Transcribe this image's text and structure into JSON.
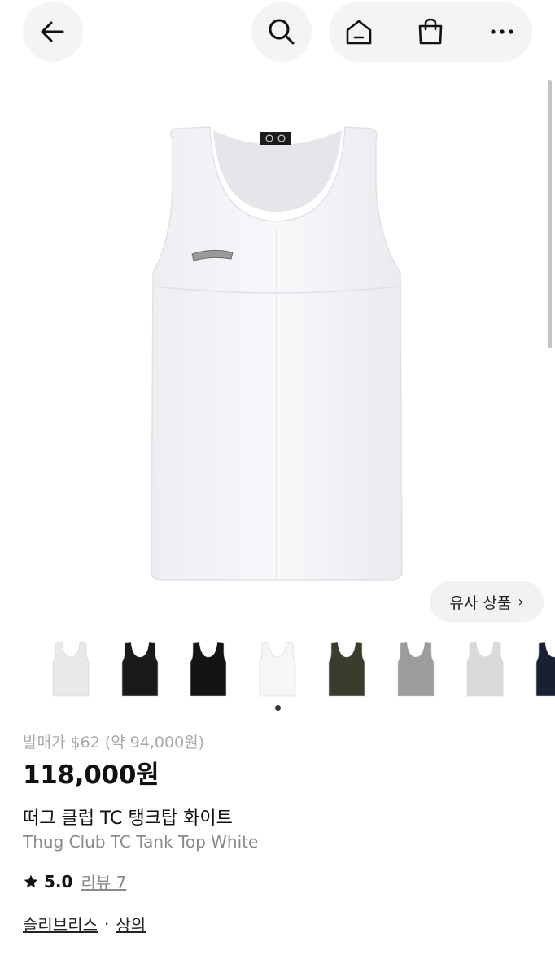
{
  "nav": {
    "icons": [
      "back-arrow-icon",
      "search-icon",
      "home-icon",
      "shopping-bag-icon",
      "more-icon"
    ]
  },
  "similar": {
    "label": "유사 상품",
    "chevron": "›"
  },
  "thumbnails": [
    {
      "color": "#e9e9e9"
    },
    {
      "color": "#1a1a1a"
    },
    {
      "color": "#141414"
    },
    {
      "color": "#f6f6f6"
    },
    {
      "color": "#3a3d2c"
    },
    {
      "color": "#9c9c9c"
    },
    {
      "color": "#d8dadc"
    },
    {
      "color": "#1a1f33"
    }
  ],
  "product": {
    "release_price": "발매가 $62 (약 94,000원)",
    "price": "118,000원",
    "name_kr": "떠그 클럽 TC 탱크탑 화이트",
    "name_en": "Thug Club TC Tank Top White",
    "rating": "5.0",
    "reviews": "리뷰 7",
    "brand": "슬리브리스",
    "separator": "·",
    "category": "상의"
  }
}
